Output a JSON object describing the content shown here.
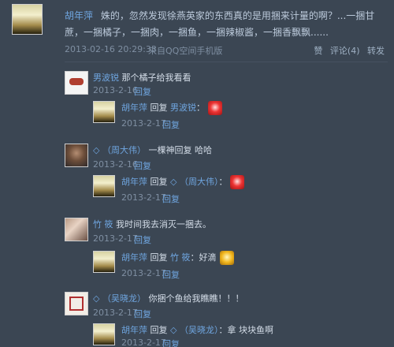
{
  "post": {
    "author": "胡年萍",
    "text": "姝的，忽然发现徐燕英家的东西真的是用捆来计量的啊？...一捆甘蔗，一捆橘子，一捆肉，一捆鱼，一捆辣椒酱，一捆香飘飘......",
    "time": "2013-02-16 20:29:33",
    "source": "来自QQ空间手机版",
    "like": "赞",
    "comment": "评论(4)",
    "forward": "转发"
  },
  "comments": [
    {
      "name": "男波锐",
      "text": "那个橘子给我看看",
      "time": "2013-2-16",
      "reply_label": "回复",
      "reply": {
        "name": "胡年萍",
        "verb": "回复",
        "target": "男波锐",
        "sep": "：",
        "text": "",
        "time": "2013-2-17",
        "reply_label": "回复"
      }
    },
    {
      "name": "◇ （周大伟）",
      "text": "一棵神回复 哈哈",
      "time": "2013-2-16",
      "reply_label": "回复",
      "reply": {
        "name": "胡年萍",
        "verb": "回复",
        "target": "◇ （周大伟）",
        "sep": "：",
        "text": "",
        "time": "2013-2-17",
        "reply_label": "回复"
      }
    },
    {
      "name": "竹 筱",
      "text": "我时间我去消灭一捆去。",
      "time": "2013-2-17",
      "reply_label": "回复",
      "reply": {
        "name": "胡年萍",
        "verb": "回复",
        "target": "竹 筱",
        "sep": "：",
        "text": "好滴",
        "time": "2013-2-17",
        "reply_label": "回复"
      }
    },
    {
      "name": "◇ （吴晓龙）",
      "text": "你捆个鱼给我瞧瞧！！！",
      "time": "2013-2-17",
      "reply_label": "回复",
      "reply": {
        "name": "胡年萍",
        "verb": "回复",
        "target": "◇ （吴晓龙）",
        "sep": "：",
        "text": "拿 块块鱼啊",
        "time": "2013-2-17",
        "reply_label": "回复"
      }
    }
  ]
}
